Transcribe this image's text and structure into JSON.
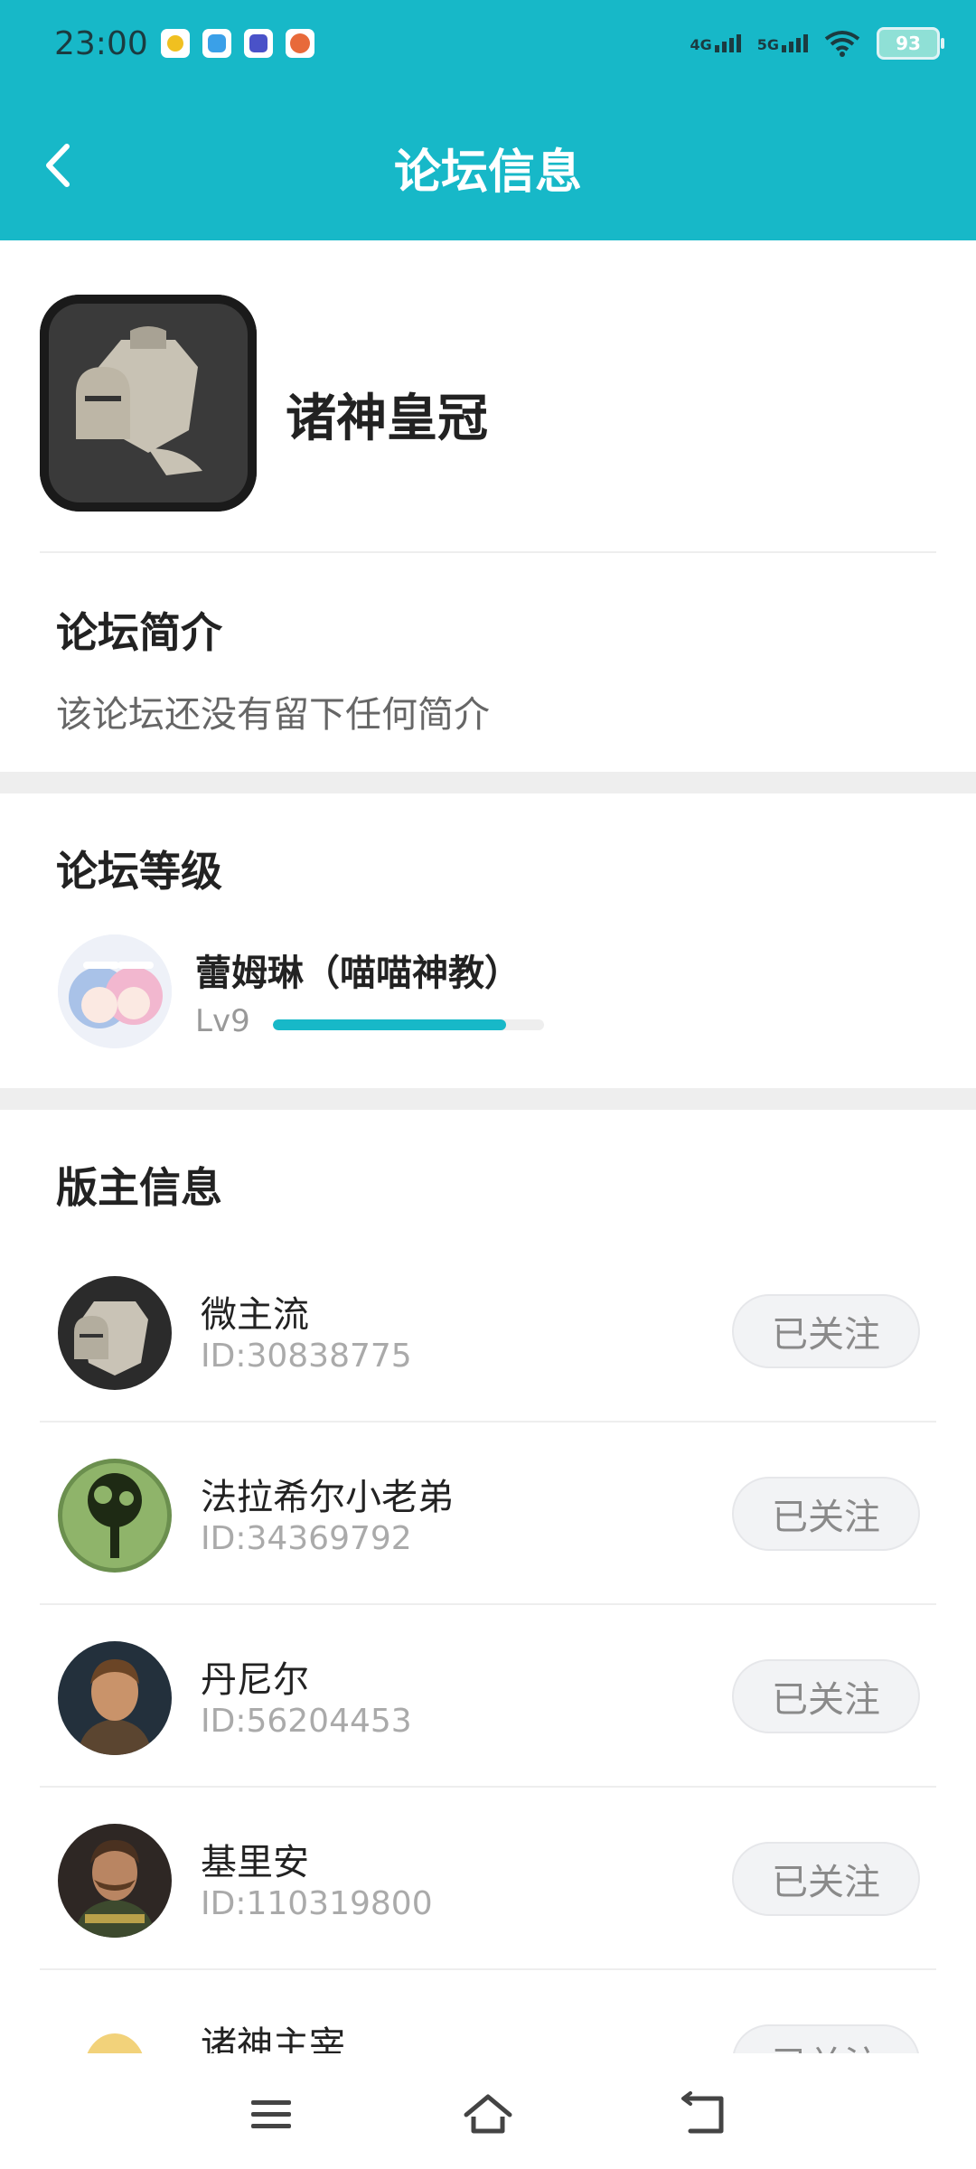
{
  "status_bar": {
    "time": "23:00",
    "network_1": "4G",
    "network_2": "5G",
    "battery": "93",
    "app_icons": [
      "green-app-icon",
      "blue-app-icon",
      "purple-app-icon",
      "orange-app-icon"
    ]
  },
  "header": {
    "title": "论坛信息",
    "back_icon": "chevron-left-icon",
    "background": "#17b8c8"
  },
  "forum": {
    "name": "诸神皇冠"
  },
  "intro": {
    "title": "论坛简介",
    "text": "该论坛还没有留下任何简介"
  },
  "level": {
    "title": "论坛等级",
    "user_name": "蕾姆琳（喵喵神教）",
    "level_label": "Lv9",
    "progress": 0.86
  },
  "moderators": {
    "title": "版主信息",
    "items": [
      {
        "name": "微主流",
        "id": "ID:30838775",
        "follow_label": "已关注"
      },
      {
        "name": "法拉希尔小老弟",
        "id": "ID:34369792",
        "follow_label": "已关注"
      },
      {
        "name": "丹尼尔",
        "id": "ID:56204453",
        "follow_label": "已关注"
      },
      {
        "name": "基里安",
        "id": "ID:110319800",
        "follow_label": "已关注"
      },
      {
        "name": "诸神主宰",
        "id": "",
        "follow_label": "已关注"
      }
    ]
  },
  "nav": {
    "icons": [
      "menu-icon",
      "home-icon",
      "back-icon"
    ]
  }
}
